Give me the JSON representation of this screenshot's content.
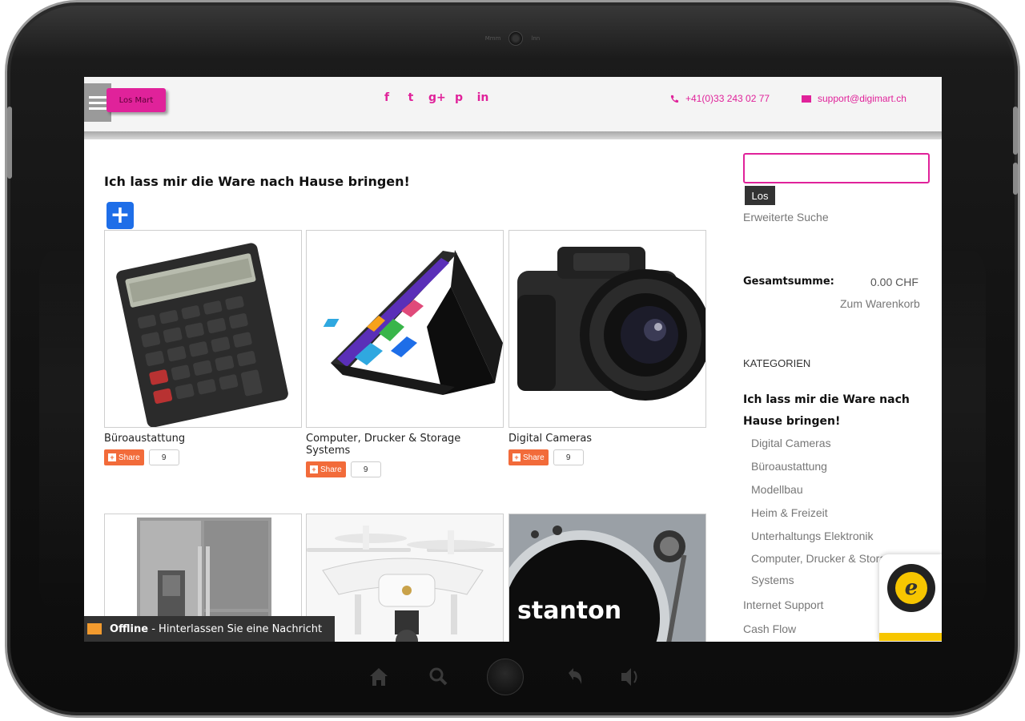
{
  "device": {
    "camera_left_label": "Mmm",
    "camera_right_label": "lnn"
  },
  "header": {
    "logo_text": "Los Mart",
    "socials": [
      "f",
      "t",
      "g+",
      "p",
      "in"
    ],
    "phone": "+41(0)33 243 02 77",
    "email": "support@digimart.ch"
  },
  "main": {
    "headline": "Ich lass mir die Ware nach Hause bringen!",
    "add_label": "+",
    "products": [
      {
        "title": "Büroaustattung",
        "share_label": "Share",
        "count": "9",
        "image": "calculator"
      },
      {
        "title": "Computer, Drucker & Storage Systems",
        "share_label": "Share",
        "count": "9",
        "image": "laptop"
      },
      {
        "title": "Digital Cameras",
        "share_label": "Share",
        "count": "9",
        "image": "camera"
      },
      {
        "title": "",
        "share_label": "",
        "count": "",
        "image": "fridge"
      },
      {
        "title": "",
        "share_label": "",
        "count": "",
        "image": "drone"
      },
      {
        "title": "",
        "share_label": "",
        "count": "",
        "image": "turntable",
        "brand": "stanton"
      }
    ]
  },
  "sidebar": {
    "search_button": "Los",
    "advanced_search": "Erweiterte Suche",
    "total_label": "Gesamtsumme:",
    "total_value": "0.00 CHF",
    "cart_link": "Zum Warenkorb",
    "categories_heading": "KATEGORIEN",
    "category_main": "Ich lass mir die Ware nach Hause bringen!",
    "category_items": [
      "Digital Cameras",
      "Büroaustattung",
      "Modellbau",
      "Heim & Freizeit",
      "Unterhaltungs Elektronik",
      "Computer, Drucker & Storage Systems"
    ],
    "extra_items": [
      "Internet Support",
      "Cash Flow"
    ],
    "trusted_mark": "e"
  },
  "chat": {
    "status": "Offline",
    "message": " - Hinterlassen Sie eine Nachricht"
  },
  "colors": {
    "accent": "#e0229a",
    "share": "#f26b3a",
    "plus_button": "#1e6ee8"
  }
}
